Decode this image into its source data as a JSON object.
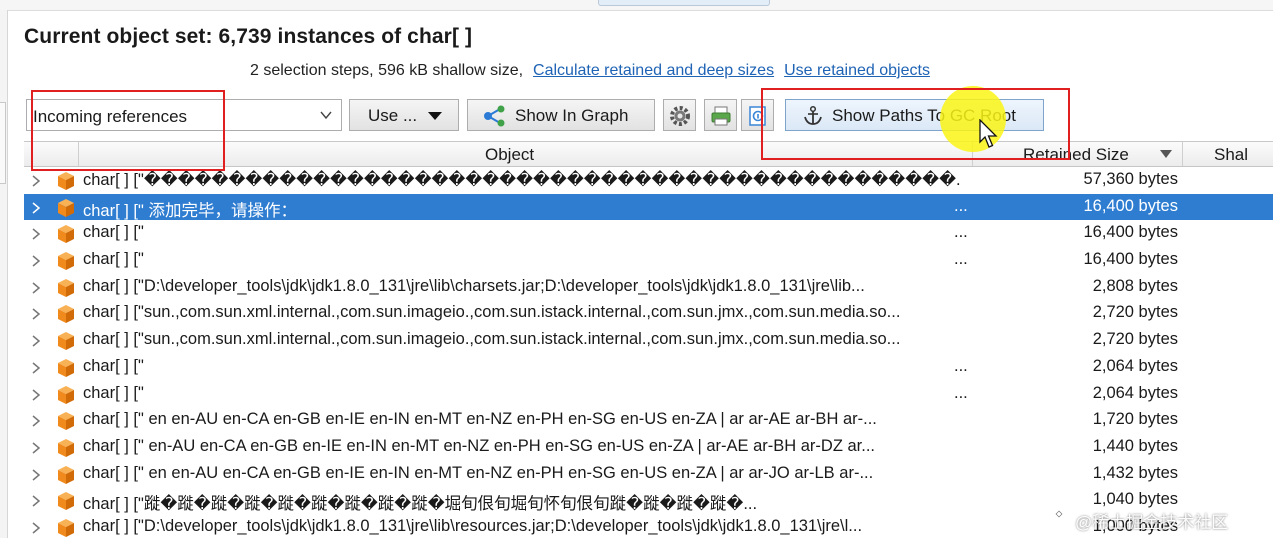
{
  "header": {
    "title": "Current object set:  6,739 instances of char[ ]",
    "summary": "2 selection steps, 596 kB shallow size,",
    "link_calculate": "Calculate retained and deep sizes",
    "link_use_retained": "Use retained objects"
  },
  "toolbar": {
    "view_select_value": "Incoming references",
    "use_button": "Use ...",
    "show_in_graph": "Show In Graph",
    "show_paths_gc_root": "Show Paths To GC Root",
    "icons": [
      "settings-gear-icon",
      "print-icon",
      "info-icon"
    ]
  },
  "table": {
    "columns": [
      "Object",
      "Retained Size",
      "Shal"
    ],
    "rows": [
      {
        "object": "char[ ] [\"������������������������������������������������...",
        "ellipsis": "",
        "size": "57,360 bytes",
        "selected": false
      },
      {
        "object": "char[ ] [\" 添加完毕，请操作：",
        "ellipsis": "...",
        "size": "16,400 bytes",
        "selected": true
      },
      {
        "object": "char[ ] [\"",
        "ellipsis": "...",
        "size": "16,400 bytes",
        "selected": false
      },
      {
        "object": "char[ ] [\"",
        "ellipsis": "...",
        "size": "16,400 bytes",
        "selected": false
      },
      {
        "object": "char[ ] [\"D:\\developer_tools\\jdk\\jdk1.8.0_131\\jre\\lib\\charsets.jar;D:\\developer_tools\\jdk\\jdk1.8.0_131\\jre\\lib...",
        "ellipsis": "",
        "size": "2,808 bytes",
        "selected": false
      },
      {
        "object": "char[ ] [\"sun.,com.sun.xml.internal.,com.sun.imageio.,com.sun.istack.internal.,com.sun.jmx.,com.sun.media.so...",
        "ellipsis": "",
        "size": "2,720 bytes",
        "selected": false
      },
      {
        "object": "char[ ] [\"sun.,com.sun.xml.internal.,com.sun.imageio.,com.sun.istack.internal.,com.sun.jmx.,com.sun.media.so...",
        "ellipsis": "",
        "size": "2,720 bytes",
        "selected": false
      },
      {
        "object": "char[ ] [\"",
        "ellipsis": "...",
        "size": "2,064 bytes",
        "selected": false
      },
      {
        "object": "char[ ] [\"",
        "ellipsis": "...",
        "size": "2,064 bytes",
        "selected": false
      },
      {
        "object": "char[ ] [\" en en-AU en-CA en-GB en-IE en-IN en-MT en-NZ en-PH en-SG en-US en-ZA | ar ar-AE ar-BH ar-...",
        "ellipsis": "",
        "size": "1,720 bytes",
        "selected": false
      },
      {
        "object": "char[ ] [\"  en-AU en-CA en-GB en-IE en-IN en-MT en-NZ en-PH en-SG en-US en-ZA |  ar-AE ar-BH ar-DZ ar...",
        "ellipsis": "",
        "size": "1,440 bytes",
        "selected": false
      },
      {
        "object": "char[ ] [\"  en en-AU en-CA en-GB en-IE en-IN en-MT en-NZ en-PH en-SG en-US en-ZA |  ar ar-JO ar-LB ar-...",
        "ellipsis": "",
        "size": "1,432 bytes",
        "selected": false
      },
      {
        "object": "char[ ] [\"蹝�蹝�蹝�蹝�蹝�蹝�蹝�蹝�蹝�堀旬佷旬堀旬怀旬佷旬蹝�蹝�蹝�蹝�...",
        "ellipsis": "",
        "size": "1,040 bytes",
        "selected": false
      },
      {
        "object": "char[ ] [\"D:\\developer_tools\\jdk\\jdk1.8.0_131\\jre\\lib\\resources.jar;D:\\developer_tools\\jdk\\jdk1.8.0_131\\jre\\l...",
        "ellipsis": "",
        "size": "1,000 bytes",
        "selected": false
      }
    ]
  },
  "watermark": "@稀土掘金技术社区",
  "colors": {
    "selection": "#2f7dd1",
    "link": "#1f63b5",
    "annotation_red": "#e02020",
    "cursor_highlight": "#faf514",
    "instance_cube": "#f08a1c"
  }
}
